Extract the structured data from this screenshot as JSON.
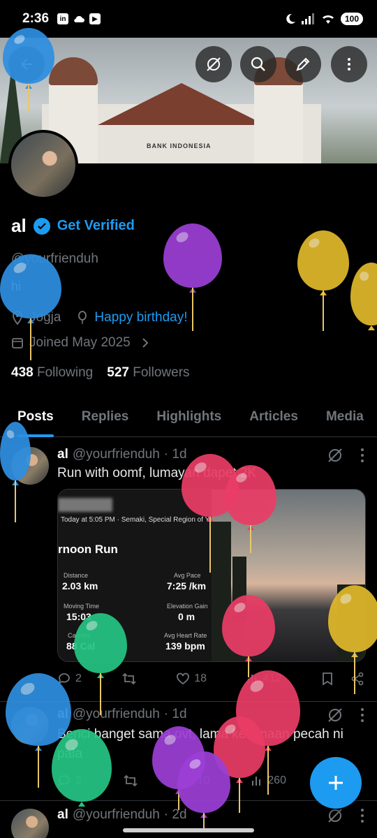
{
  "status_bar": {
    "time": "2:36",
    "battery": "100"
  },
  "profile": {
    "name": "al",
    "get_verified": "Get Verified",
    "handle": "@yourfrienduh",
    "bio": "hi",
    "location": "Jogja",
    "birthday": "Happy birthday!",
    "joined": "Joined May 2025",
    "following_count": "438",
    "following_label": "Following",
    "followers_count": "527",
    "followers_label": "Followers"
  },
  "banner": {
    "building_sign": "BANK INDONESIA"
  },
  "tabs": [
    "Posts",
    "Replies",
    "Highlights",
    "Articles",
    "Media"
  ],
  "posts": [
    {
      "name": "al",
      "handle": "@yourfrienduh",
      "time": "· 1d",
      "text": "Run with oomf, lumayan dapet 2K",
      "run_card": {
        "meta": "Today at 5:05 PM · Semaki, Special Region of Yog",
        "title": "rnoon Run",
        "distance_label": "Distance",
        "distance": "2.03 km",
        "pace_label": "Avg Pace",
        "pace": "7:25 /km",
        "moving_label": "Moving Time",
        "moving": "15:03",
        "elev_label": "Elevation Gain",
        "elev": "0 m",
        "cal_label": "Calories",
        "cal": "88 Cal",
        "hr_label": "Avg Heart Rate",
        "hr": "139 bpm"
      },
      "replies": "2",
      "reposts": "",
      "likes": "18",
      "views": "412"
    },
    {
      "name": "al",
      "handle": "@yourfrienduh",
      "time": "· 1d",
      "text": "Benci banget sama ovt, lama kelamaan pecah ni pala",
      "replies": "2",
      "reposts": "",
      "likes": "10",
      "views": "260"
    },
    {
      "name": "al",
      "handle": "@yourfrienduh",
      "time": "· 2d"
    }
  ],
  "colors": {
    "accent": "#1d9bf0",
    "background": "#000000",
    "muted": "#71767b"
  }
}
